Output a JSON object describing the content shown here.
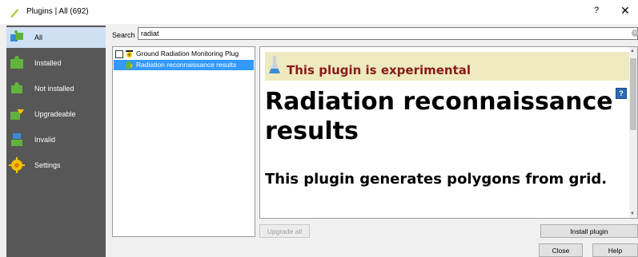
{
  "window": {
    "title": "Plugins | All (692)",
    "help_label": "?",
    "close_label": "✕"
  },
  "sidebar": {
    "items": [
      {
        "label": "All",
        "icon": "puzzle-all-icon"
      },
      {
        "label": "Installed",
        "icon": "puzzle-installed-icon"
      },
      {
        "label": "Not installed",
        "icon": "puzzle-not-installed-icon"
      },
      {
        "label": "Upgradeable",
        "icon": "puzzle-upgradeable-icon"
      },
      {
        "label": "Invalid",
        "icon": "puzzle-invalid-icon"
      },
      {
        "label": "Settings",
        "icon": "settings-gear-icon"
      }
    ]
  },
  "search": {
    "label": "Search",
    "value": "radiat"
  },
  "plugin_list": [
    {
      "label": "Ground Radiation Monitoring Plug",
      "checked": false,
      "selected": false
    },
    {
      "label": "Radiation reconnaissance results",
      "selected": true
    }
  ],
  "details": {
    "banner": "This plugin is experimental",
    "help_icon_label": "?",
    "title": "Radiation reconnaissance results",
    "description": "This plugin generates polygons from grid."
  },
  "buttons": {
    "upgrade_all": "Upgrade all",
    "install_plugin": "Install plugin",
    "close": "Close",
    "help": "Help"
  },
  "colors": {
    "sidebar_bg": "#575757",
    "selection": "#3399ff",
    "banner_bg": "#eeeabf",
    "banner_text": "#8b1a1a"
  }
}
